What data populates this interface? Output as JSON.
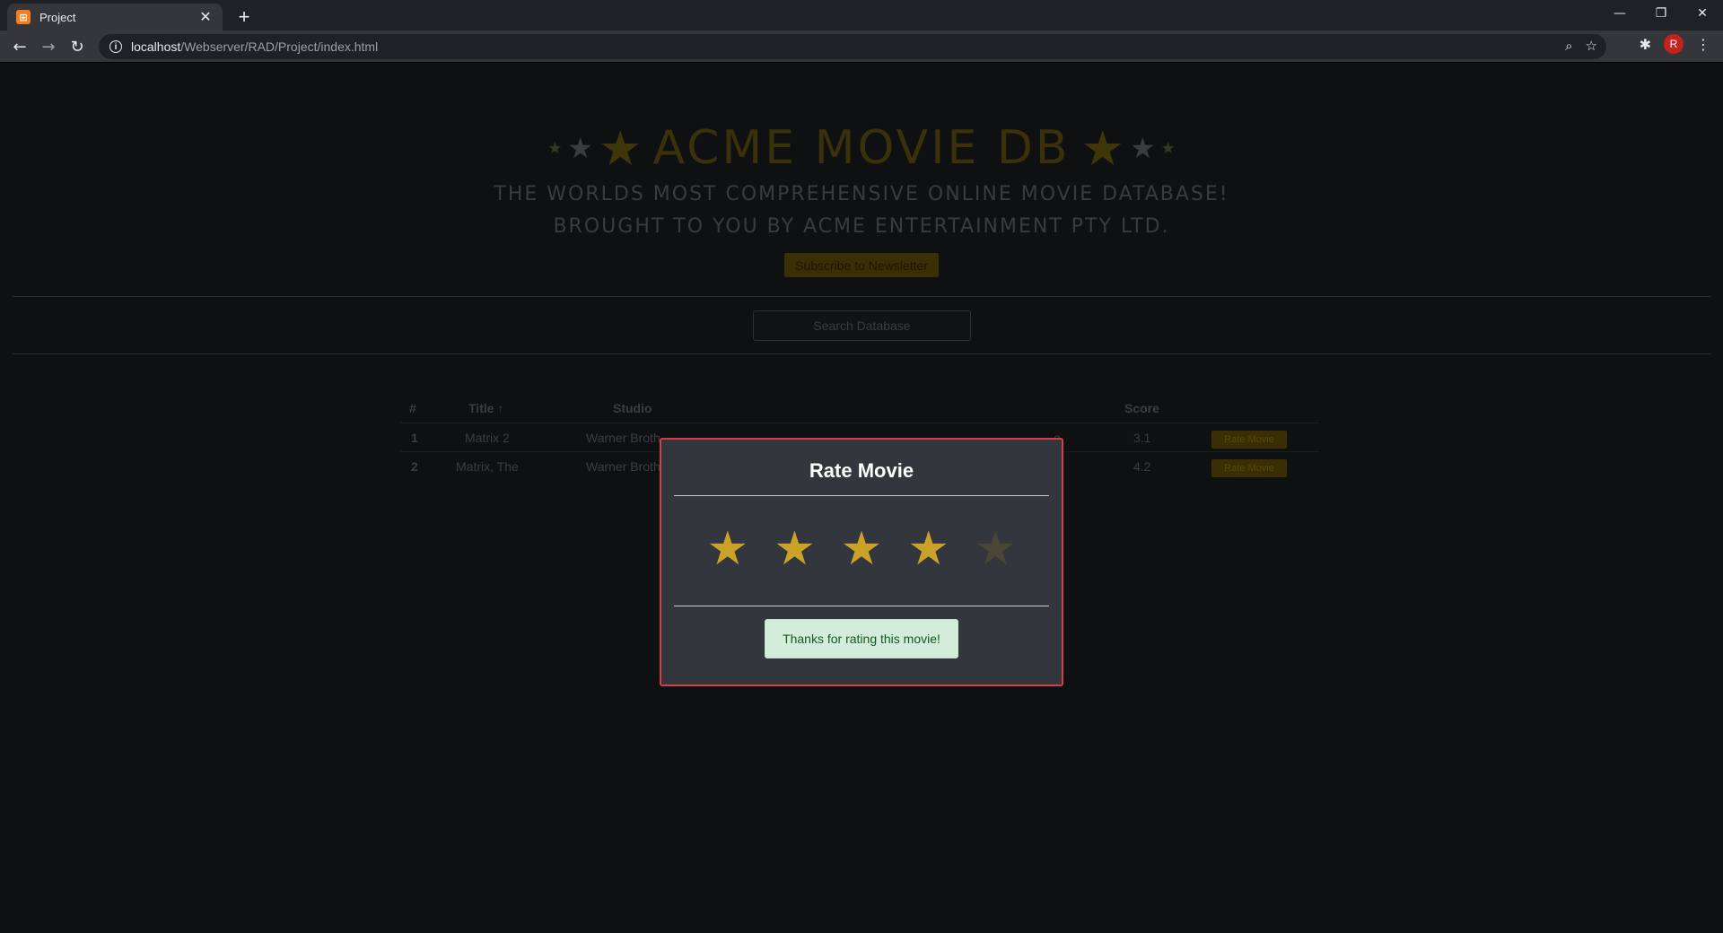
{
  "browser": {
    "tab_title": "Project",
    "favicon_glyph": "⊞",
    "url_host": "localhost",
    "url_path": "/Webserver/RAD/Project/index.html",
    "profile_initial": "R"
  },
  "header": {
    "title": "ACME MOVIE DB",
    "tagline_1": "THE WORLDS MOST COMPREHENSIVE ONLINE MOVIE DATABASE!",
    "tagline_2": "BROUGHT TO YOU BY ACME ENTERTAINMENT PTY LTD.",
    "subscribe_label": "Subscribe to Newsletter"
  },
  "search": {
    "placeholder": "Search Database"
  },
  "table": {
    "headers": {
      "num": "#",
      "title": "Title ↑",
      "studio": "Studio",
      "score": "Score"
    },
    "rows": [
      {
        "num": "1",
        "title": "Matrix 2",
        "studio": "Warner Broth",
        "extra": "e",
        "score": "3.1",
        "action": "Rate Movie"
      },
      {
        "num": "2",
        "title": "Matrix, The",
        "studio": "Warner Broth",
        "extra": "",
        "score": "4.2",
        "action": "Rate Movie"
      }
    ]
  },
  "modal": {
    "title": "Rate Movie",
    "rating": 4,
    "max_rating": 5,
    "star_glyph": "★",
    "message": "Thanks for rating this movie!",
    "colors": {
      "border": "#d63c4a",
      "star_on": "#c9a227",
      "star_off": "#4a4636",
      "alert_bg": "#d4edda",
      "alert_text": "#155724"
    }
  }
}
